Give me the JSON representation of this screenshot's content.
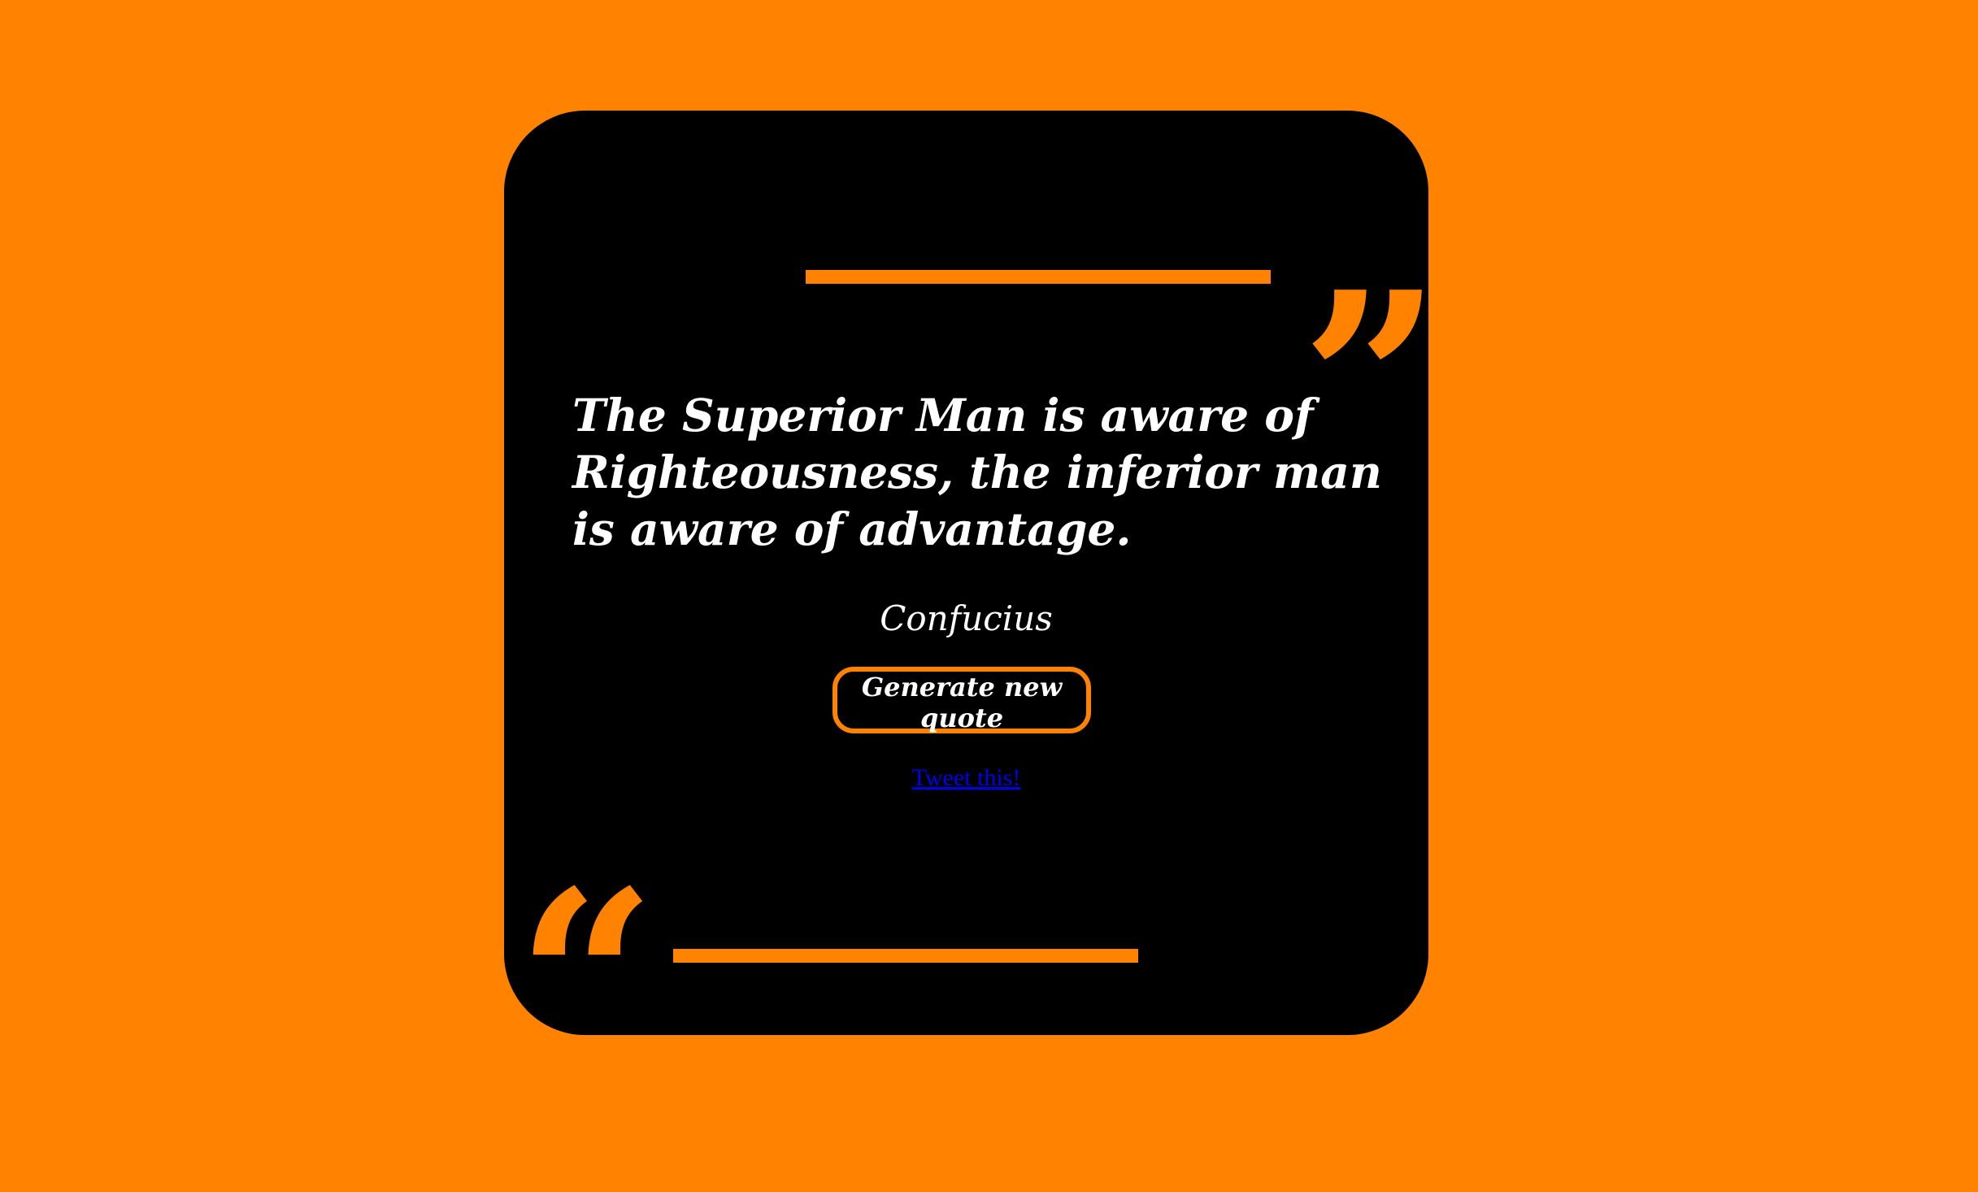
{
  "colors": {
    "background": "#FF8200",
    "card": "#000000",
    "accent": "#FF8200",
    "text": "#FFFFFF",
    "link": "#0000EE"
  },
  "quote": {
    "open_mark": "“",
    "close_mark": "”",
    "text": "The Superior Man is aware of Righteousness, the inferior man is aware of advantage.",
    "author": "Confucius"
  },
  "actions": {
    "new_quote_label": "Generate new quote",
    "tweet_label": "Tweet this!"
  }
}
